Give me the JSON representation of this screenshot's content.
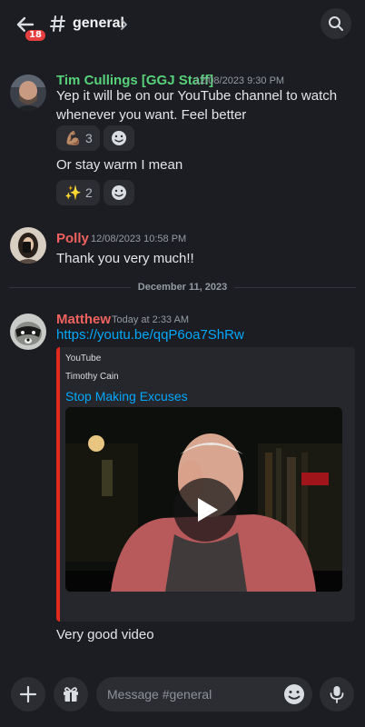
{
  "header": {
    "channel_name": "general",
    "unread_badge": "18",
    "icons": [
      "back-arrow-icon",
      "hash-icon",
      "chevron-right-icon",
      "search-icon"
    ]
  },
  "messages": [
    {
      "author": "Tim Cullings [GGJ Staff]",
      "author_color": "#57d27a",
      "timestamp": "12/08/2023 9:30 PM",
      "text": "Yep it will be on our YouTube channel to watch whenever you want. Feel better",
      "reactions": [
        {
          "emoji": "💪🏽",
          "count": "3"
        }
      ],
      "followup_text": "Or stay warm I mean",
      "followup_reactions": [
        {
          "emoji": "✨",
          "count": "2"
        }
      ]
    },
    {
      "author": "Polly",
      "author_color": "#f0625f",
      "timestamp": "12/08/2023 10:58 PM",
      "text": "Thank you very much!!"
    },
    {
      "author": "Matthew",
      "author_color": "#f0625f",
      "timestamp": "Today at 2:33 AM",
      "link": "https://youtu.be/qqP6oa7ShRw",
      "embed": {
        "provider": "YouTube",
        "author": "Timothy Cain",
        "title": "Stop Making Excuses",
        "accent_color": "#e1291f"
      },
      "followup_text": "Very good video"
    }
  ],
  "date_divider": "December 11, 2023",
  "composer": {
    "placeholder": "Message #general",
    "icons": [
      "plus-icon",
      "gift-icon",
      "emoji-icon",
      "microphone-icon"
    ]
  }
}
